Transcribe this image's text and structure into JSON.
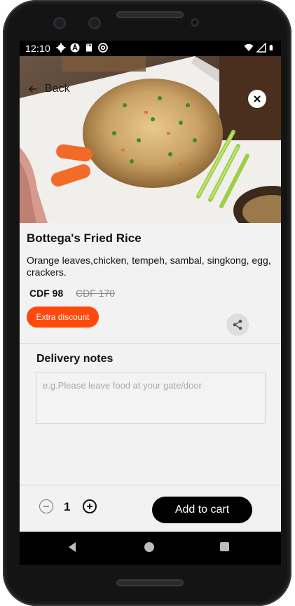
{
  "status_bar": {
    "time": "12:10",
    "left_icons": [
      "gear-icon",
      "nav-a-icon",
      "sd-card-icon",
      "at-sign-icon"
    ],
    "right_icons": [
      "wifi-icon",
      "signal-icon",
      "battery-icon"
    ]
  },
  "header": {
    "back_label": "Back",
    "close_icon": "close-icon"
  },
  "product": {
    "name": "Bottega's Fried Rice",
    "description": "Orange leaves,chicken, tempeh, sambal, singkong, egg, crackers.",
    "price": "CDF 98",
    "original_price": "CDF 170",
    "discount_label": "Extra discount"
  },
  "delivery_notes": {
    "label": "Delivery notes",
    "placeholder": "e.g.Please leave food at your gate/door"
  },
  "cart": {
    "quantity": "1",
    "add_label": "Add to cart"
  },
  "colors": {
    "accent": "#fd4a0c",
    "button_dark": "#000000",
    "background": "#f2f2f2"
  }
}
